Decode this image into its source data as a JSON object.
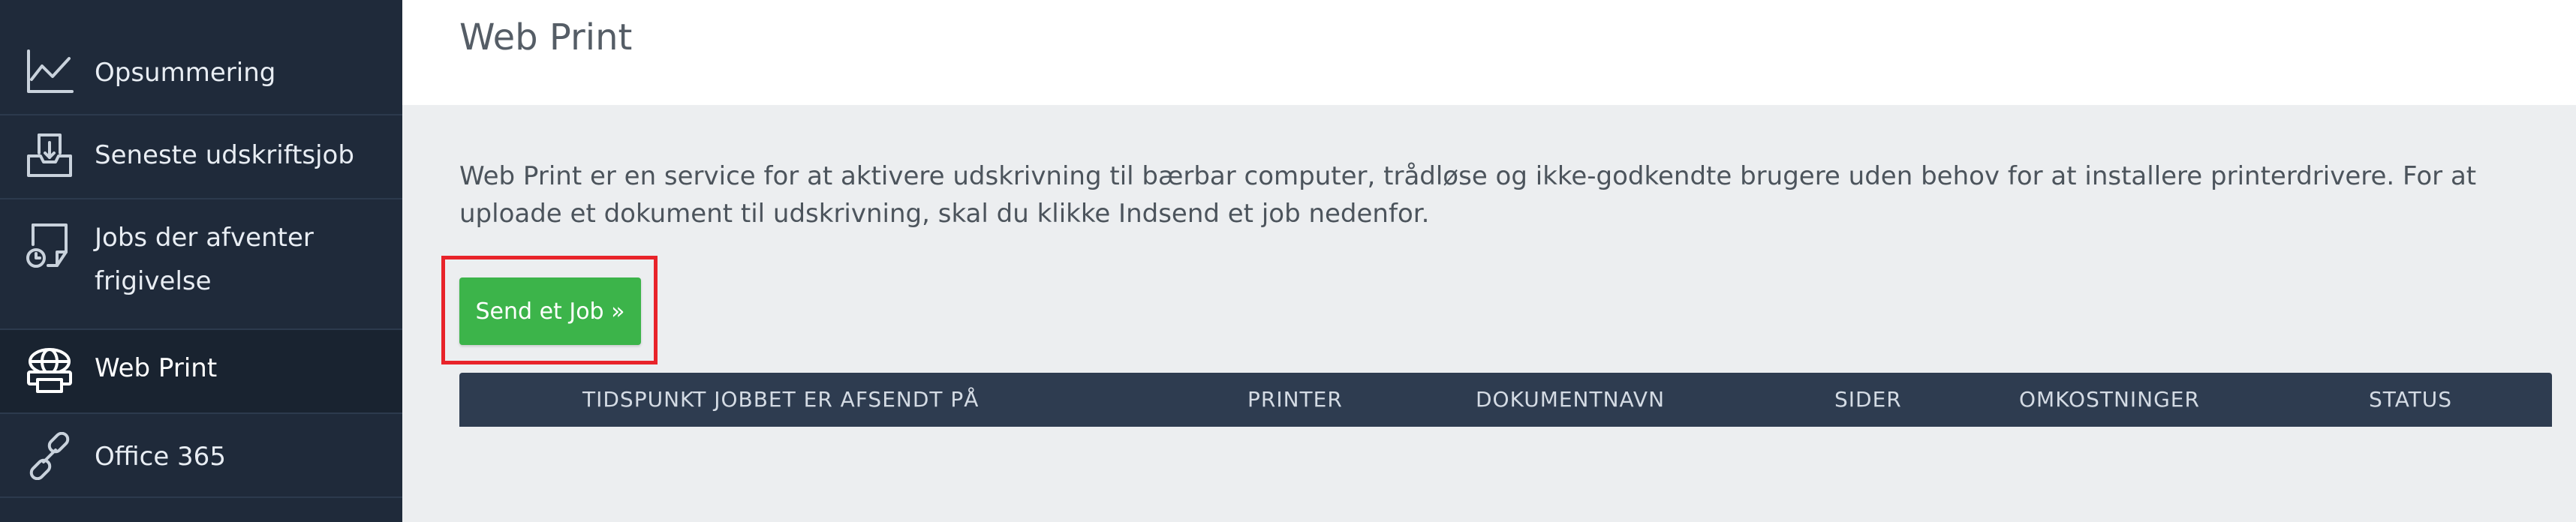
{
  "sidebar": {
    "items": [
      {
        "label": "Opsummering",
        "icon": "line-chart-icon",
        "active": false
      },
      {
        "label": "Seneste udskriftsjob",
        "icon": "print-tray-icon",
        "active": false
      },
      {
        "label_line1": "Jobs der afventer",
        "label_line2": "frigivelse",
        "icon": "pending-release-icon",
        "active": false
      },
      {
        "label": "Web Print",
        "icon": "web-print-icon",
        "active": true
      },
      {
        "label": "Office 365",
        "icon": "link-icon",
        "active": false
      }
    ]
  },
  "header": {
    "title": "Web Print"
  },
  "main": {
    "description": "Web Print er en service for at aktivere udskrivning til bærbar computer, trådløse og ikke-godkendte brugere uden behov for at installere printerdrivere. For at uploade et dokument til udskrivning, skal du klikke Indsend et job nedenfor.",
    "send_button_label": "Send et Job »",
    "table": {
      "columns": [
        "TIDSPUNKT JOBBET ER AFSENDT PÅ",
        "PRINTER",
        "DOKUMENTNAVN",
        "SIDER",
        "OMKOSTNINGER",
        "STATUS"
      ]
    }
  },
  "colors": {
    "sidebar_bg": "#1f2a3a",
    "button_green": "#3cb44a",
    "highlight_red": "#e8232a",
    "table_header_bg": "#2e3c50"
  }
}
